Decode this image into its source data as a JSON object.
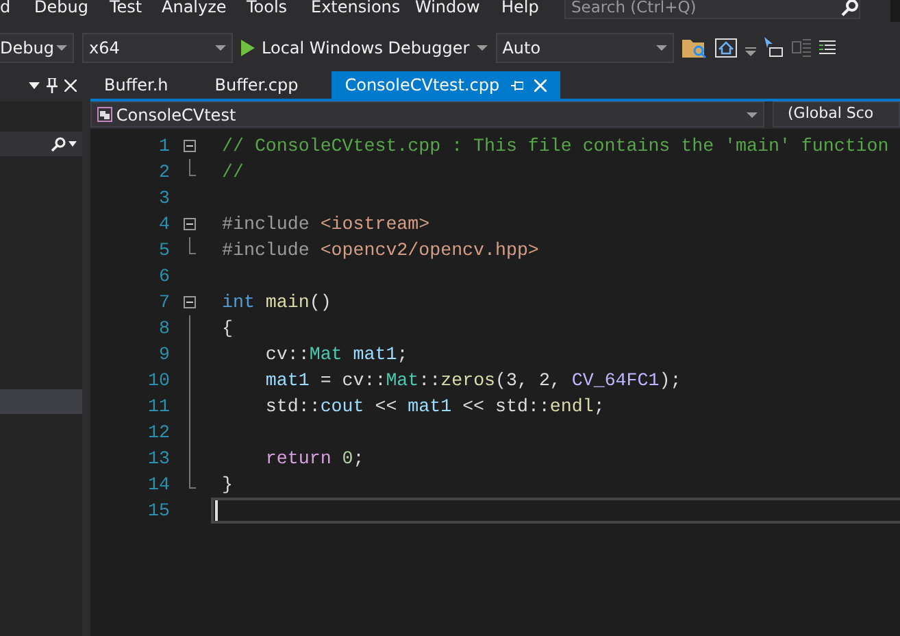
{
  "menu": [
    "d",
    "Debug",
    "Test",
    "Analyze",
    "Tools",
    "Extensions",
    "Window",
    "Help"
  ],
  "search": {
    "placeholder": "Search (Ctrl+Q)"
  },
  "toolbar": {
    "configuration": "Debug",
    "platform": "x64",
    "run_label": "Local Windows Debugger",
    "mode": "Auto"
  },
  "tabs": [
    {
      "label": "Buffer.h",
      "selected": false
    },
    {
      "label": "Buffer.cpp",
      "selected": false
    },
    {
      "label": "ConsoleCVtest.cpp",
      "selected": true
    }
  ],
  "navigation": {
    "project": "ConsoleCVtest",
    "scope": "(Global Sco"
  },
  "code": [
    {
      "number": "1",
      "fold_start": true,
      "in_fold": false,
      "current": false,
      "tokens": [
        {
          "text": "// ConsoleCVtest.cpp : This file contains the 'main' function",
          "kind": "comment"
        }
      ]
    },
    {
      "number": "2",
      "fold_start": false,
      "in_fold": true,
      "current": false,
      "tokens": [
        {
          "text": "//",
          "kind": "comment"
        }
      ]
    },
    {
      "number": "3",
      "fold_start": false,
      "in_fold": false,
      "current": false
    },
    {
      "number": "4",
      "fold_start": true,
      "in_fold": false,
      "current": false,
      "tokens": [
        {
          "text": "#include",
          "kind": "preproc"
        },
        {
          "text": " <iostream>",
          "kind": "string"
        }
      ]
    },
    {
      "number": "5",
      "fold_start": false,
      "in_fold": true,
      "current": false,
      "tokens": [
        {
          "text": "#include",
          "kind": "preproc"
        },
        {
          "text": " <opencv2/opencv.hpp>",
          "kind": "string"
        }
      ]
    },
    {
      "number": "6",
      "fold_start": false,
      "in_fold": false,
      "current": false
    },
    {
      "number": "7",
      "fold_start": true,
      "in_fold": false,
      "current": false,
      "tokens": [
        {
          "text": "int",
          "kind": "keyword"
        },
        {
          "text": " main",
          "kind": "function"
        },
        {
          "text": "()",
          "kind": "plain"
        }
      ]
    },
    {
      "number": "8",
      "fold_start": false,
      "in_fold": true,
      "current": false,
      "tokens": [
        {
          "text": "{",
          "kind": "plain"
        }
      ]
    },
    {
      "number": "9",
      "fold_start": false,
      "in_fold": true,
      "current": false,
      "tokens": [
        {
          "text": "    cv::",
          "kind": "plain"
        },
        {
          "text": "Mat",
          "kind": "type"
        },
        {
          "text": " mat1",
          "kind": "variable"
        },
        {
          "text": ";",
          "kind": "plain"
        }
      ]
    },
    {
      "number": "10",
      "fold_start": false,
      "in_fold": true,
      "current": false,
      "tokens": [
        {
          "text": "    mat1",
          "kind": "variable"
        },
        {
          "text": " = cv::",
          "kind": "plain"
        },
        {
          "text": "Mat",
          "kind": "type"
        },
        {
          "text": "::",
          "kind": "plain"
        },
        {
          "text": "zeros",
          "kind": "function"
        },
        {
          "text": "(3, 2, ",
          "kind": "plain"
        },
        {
          "text": "CV_64FC1",
          "kind": "macro"
        },
        {
          "text": ");",
          "kind": "plain"
        }
      ]
    },
    {
      "number": "11",
      "fold_start": false,
      "in_fold": true,
      "current": false,
      "tokens": [
        {
          "text": "    std::",
          "kind": "plain"
        },
        {
          "text": "cout",
          "kind": "variable"
        },
        {
          "text": " << ",
          "kind": "plain"
        },
        {
          "text": "mat1",
          "kind": "variable"
        },
        {
          "text": " << std::",
          "kind": "plain"
        },
        {
          "text": "endl",
          "kind": "function"
        },
        {
          "text": ";",
          "kind": "plain"
        }
      ]
    },
    {
      "number": "12",
      "fold_start": false,
      "in_fold": true,
      "current": false
    },
    {
      "number": "13",
      "fold_start": false,
      "in_fold": true,
      "current": false,
      "tokens": [
        {
          "text": "    return",
          "kind": "control"
        },
        {
          "text": " 0",
          "kind": "number"
        },
        {
          "text": ";",
          "kind": "plain"
        }
      ]
    },
    {
      "number": "14",
      "fold_start": false,
      "in_fold": true,
      "current": false,
      "tokens": [
        {
          "text": "}",
          "kind": "plain"
        }
      ]
    },
    {
      "number": "15",
      "fold_start": false,
      "in_fold": false,
      "current": true
    }
  ]
}
